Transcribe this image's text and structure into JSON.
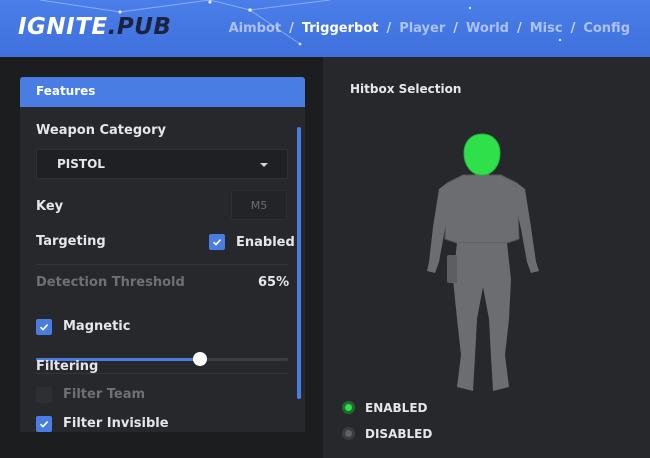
{
  "header": {
    "logo_part1": "IGNITE",
    "logo_part2": ".PUB",
    "tabs": [
      {
        "label": "Aimbot",
        "active": false
      },
      {
        "label": "Triggerbot",
        "active": true
      },
      {
        "label": "Player",
        "active": false
      },
      {
        "label": "World",
        "active": false
      },
      {
        "label": "Misc",
        "active": false
      },
      {
        "label": "Config",
        "active": false
      }
    ],
    "separator": "/"
  },
  "features": {
    "title": "Features",
    "weapon_category_label": "Weapon Category",
    "weapon_category_value": "PISTOL",
    "key_label": "Key",
    "key_value": "M5",
    "targeting_label": "Targeting",
    "targeting_enabled_label": "Enabled",
    "targeting_enabled": true,
    "detection_threshold_label": "Detection Threshold",
    "detection_threshold_value": "65%",
    "detection_threshold_fraction": 0.65,
    "magnetic_label": "Magnetic",
    "magnetic_checked": true,
    "filtering_label": "Filtering",
    "filter_team_label": "Filter Team",
    "filter_team_checked": false,
    "filter_invisible_label": "Filter Invisible",
    "filter_invisible_checked": true
  },
  "hitbox": {
    "title": "Hitbox Selection",
    "head_selected": true,
    "legend_enabled": "ENABLED",
    "legend_disabled": "DISABLED"
  },
  "colors": {
    "accent": "#4a7de4",
    "enabled_green": "#2ee04a",
    "disabled_gray": "#5e6167",
    "body_gray": "#6b6d70"
  },
  "icons": {
    "dropdown": "chevron-down-icon",
    "checkbox": "check-icon"
  }
}
